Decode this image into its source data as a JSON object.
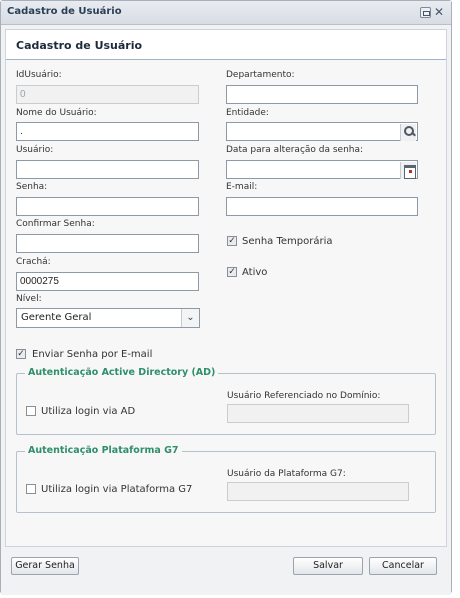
{
  "window": {
    "title": "Cadastro de Usuário"
  },
  "panel": {
    "title": "Cadastro de Usuário"
  },
  "form": {
    "id_label": "IdUsuário:",
    "id_value": "0",
    "departamento_label": "Departamento:",
    "departamento_value": "",
    "nome_label": "Nome do Usuário:",
    "nome_value": ".",
    "entidade_label": "Entidade:",
    "entidade_value": "",
    "usuario_label": "Usuário:",
    "usuario_value": "",
    "data_label": "Data para alteração da senha:",
    "data_value": "",
    "senha_label": "Senha:",
    "senha_value": "",
    "email_label": "E-mail:",
    "email_value": "",
    "confirmar_label": "Confirmar Senha:",
    "confirmar_value": "",
    "senha_temporaria_label": "Senha Temporária",
    "senha_temporaria_checked": true,
    "cracha_label": "Crachá:",
    "cracha_value": "0000275",
    "ativo_label": "Ativo",
    "ativo_checked": true,
    "nivel_label": "Nível:",
    "nivel_value": "Gerente Geral",
    "enviar_label": "Enviar Senha por E-mail",
    "enviar_checked": true
  },
  "ad": {
    "legend": "Autenticação Active Directory (AD)",
    "checkbox_label": "Utiliza login via AD",
    "checked": false,
    "field_label": "Usuário Referenciado no Domínio:",
    "field_value": ""
  },
  "g7": {
    "legend": "Autenticação Plataforma G7",
    "checkbox_label": "Utiliza login via Plataforma G7",
    "checked": false,
    "field_label": "Usuário da Plataforma G7:",
    "field_value": ""
  },
  "buttons": {
    "gerar": "Gerar Senha",
    "salvar": "Salvar",
    "cancelar": "Cancelar"
  },
  "colors": {
    "accent": "#2e8f6b",
    "title": "#2c3e55"
  }
}
